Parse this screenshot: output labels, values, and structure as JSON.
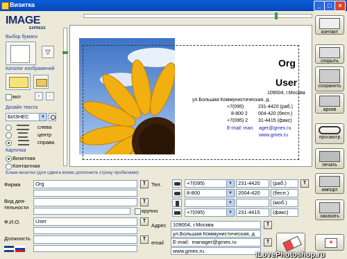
{
  "window": {
    "title": "Визитка",
    "min": "_",
    "max": "□",
    "close": "×"
  },
  "logo": {
    "line1": "IMAGE",
    "line2": "EXPRESS"
  },
  "left": {
    "paper_label": "Выбор бумаги",
    "catalog_label": "Каталог изображений",
    "vkl_label": "вкл",
    "plus": "+",
    "minus": "-",
    "design_label": "Дизайн текста",
    "design_value": "БИЗНЕС",
    "align_left": "слева",
    "align_center": "центр",
    "align_right": "справа",
    "card_label": "Карточка",
    "card_type1": "Визитная",
    "card_type2": "Контактная"
  },
  "card": {
    "org": "Org",
    "user": "User",
    "addr1": "109004, г.Москва",
    "addr2": "ул.Большая Коммунистическая, д.",
    "ph1_code": "+7(095)",
    "ph1": "231-4420 (раб.)",
    "ph2_code": "8-800 2",
    "ph2": "004-420 (бесп.)",
    "ph3_code": "+7(095) 2",
    "ph3": "31-4415 (факс)",
    "email_pref": "E-mail: man",
    "email_rest": "ager@gmex.ru",
    "www": "www.gmex.ru"
  },
  "form": {
    "hint": "Бланк визитки (для сдвига влево дополните строку пробелами)",
    "firm_label": "Фирма",
    "firm_value": "Org",
    "activity_label1": "Вид дея-",
    "activity_label2": "тельности",
    "krupno": "крупно",
    "fio_label": "Ф.И.О.",
    "fio_value": "User",
    "position_label": "Должность",
    "tel_label": "Тел.",
    "phones": [
      {
        "code": "+7(095)",
        "number": "231-4420",
        "type": "(раб.)"
      },
      {
        "code": "8-800",
        "number": "2004-420",
        "type": "(бесп.)"
      },
      {
        "code": "",
        "number": "",
        "type": "(моб.)"
      },
      {
        "code": "+7(095)",
        "number": "231-4415",
        "type": "(факс)"
      }
    ],
    "address_label": "Адрес",
    "address1": "109004, г.Москва",
    "address2": "ул.Большая Коммунистическая, д",
    "email_label": "email",
    "email_prefix": "E-mail:",
    "email_value": "manager@gmex.ru",
    "www_value": "www.gmex.ru",
    "t_btn": "T"
  },
  "right": {
    "contact": "контакт",
    "open": "открыть",
    "save": "сохранить",
    "archive": "архив",
    "preview": "просмотр",
    "print": "печать",
    "import": "импорт",
    "order": "заказать"
  },
  "watermark": "ILovePhotoshop.ru"
}
